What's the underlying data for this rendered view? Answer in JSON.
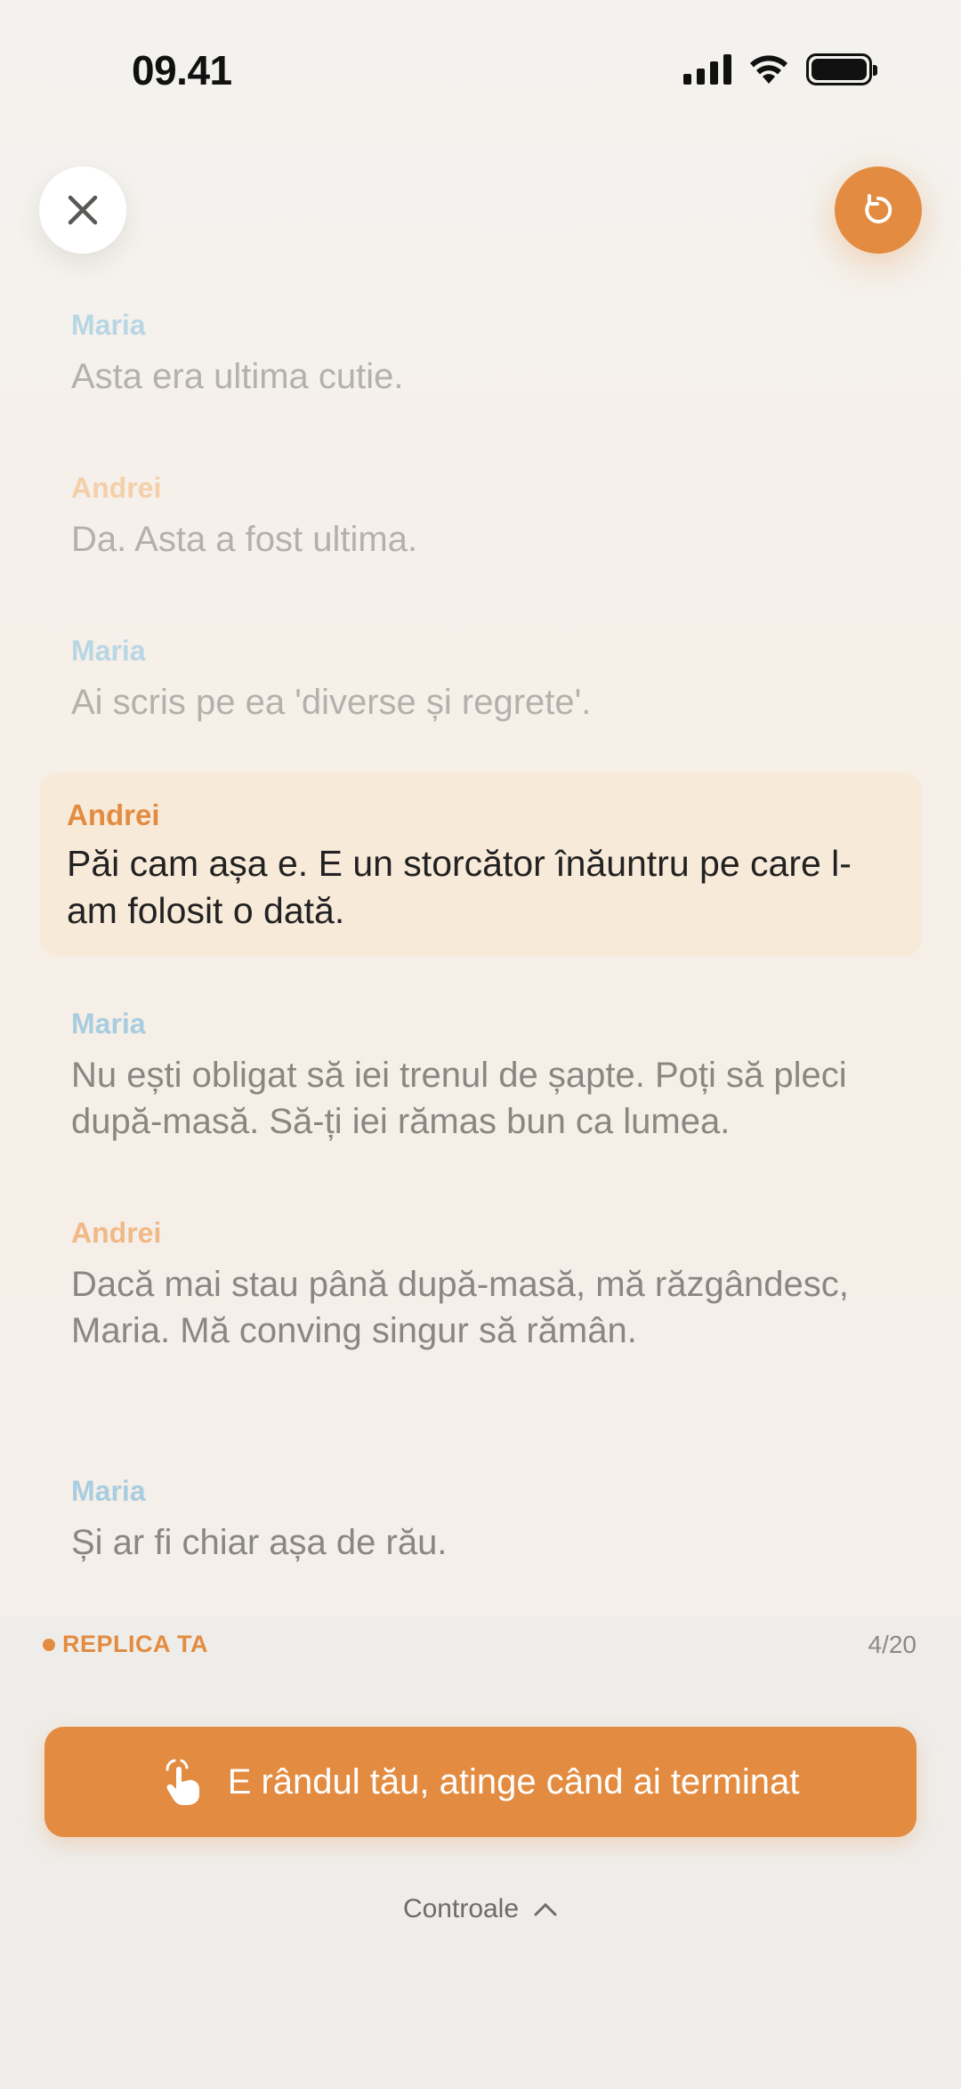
{
  "status_bar": {
    "time": "09.41"
  },
  "transcript": [
    {
      "speaker": "Maria",
      "text": "Asta era ultima cutie."
    },
    {
      "speaker": "Andrei",
      "text": "Da. Asta a fost ultima."
    },
    {
      "speaker": "Maria",
      "text": "Ai scris pe ea 'diverse și regrete'."
    },
    {
      "speaker": "Andrei",
      "text": "Păi cam așa e. E un storcător înăuntru pe care l-am folosit o dată."
    },
    {
      "speaker": "Maria",
      "text": "Nu ești obligat să iei trenul de șapte. Poți să pleci după-masă. Să-ți iei rămas bun ca lumea."
    },
    {
      "speaker": "Andrei",
      "text": "Dacă mai stau până după-masă, mă răzgândesc, Maria. Mă conving singur să rămân."
    },
    {
      "speaker": "Maria",
      "text": "Și ar fi chiar așa de rău."
    }
  ],
  "panel": {
    "replica_label": "REPLICA TA",
    "counter": "4/20",
    "turn_button_label": "E rândul tău, atinge când ai terminat",
    "controls_label": "Controale"
  },
  "icons": {
    "close": "close-icon",
    "restart": "restart-icon",
    "tap": "tap-hand-icon",
    "chevron": "chevron-up-icon"
  },
  "colors": {
    "accent": "#e38c41",
    "maria": "#a9cde0",
    "active_bg": "#f8ead9"
  }
}
